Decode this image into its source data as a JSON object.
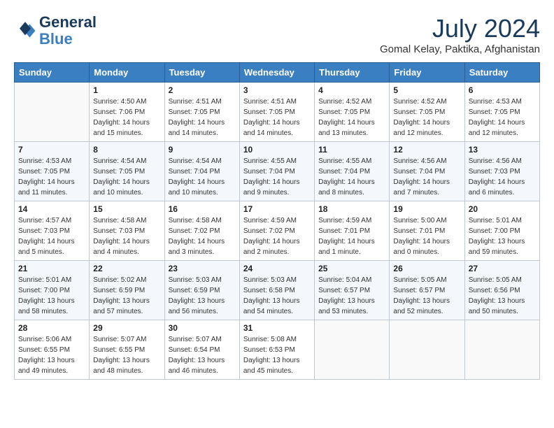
{
  "header": {
    "logo_line1": "General",
    "logo_line2": "Blue",
    "month_year": "July 2024",
    "location": "Gomal Kelay, Paktika, Afghanistan"
  },
  "weekdays": [
    "Sunday",
    "Monday",
    "Tuesday",
    "Wednesday",
    "Thursday",
    "Friday",
    "Saturday"
  ],
  "weeks": [
    [
      {
        "day": "",
        "sunrise": "",
        "sunset": "",
        "daylight": ""
      },
      {
        "day": "1",
        "sunrise": "Sunrise: 4:50 AM",
        "sunset": "Sunset: 7:06 PM",
        "daylight": "Daylight: 14 hours and 15 minutes."
      },
      {
        "day": "2",
        "sunrise": "Sunrise: 4:51 AM",
        "sunset": "Sunset: 7:05 PM",
        "daylight": "Daylight: 14 hours and 14 minutes."
      },
      {
        "day": "3",
        "sunrise": "Sunrise: 4:51 AM",
        "sunset": "Sunset: 7:05 PM",
        "daylight": "Daylight: 14 hours and 14 minutes."
      },
      {
        "day": "4",
        "sunrise": "Sunrise: 4:52 AM",
        "sunset": "Sunset: 7:05 PM",
        "daylight": "Daylight: 14 hours and 13 minutes."
      },
      {
        "day": "5",
        "sunrise": "Sunrise: 4:52 AM",
        "sunset": "Sunset: 7:05 PM",
        "daylight": "Daylight: 14 hours and 12 minutes."
      },
      {
        "day": "6",
        "sunrise": "Sunrise: 4:53 AM",
        "sunset": "Sunset: 7:05 PM",
        "daylight": "Daylight: 14 hours and 12 minutes."
      }
    ],
    [
      {
        "day": "7",
        "sunrise": "Sunrise: 4:53 AM",
        "sunset": "Sunset: 7:05 PM",
        "daylight": "Daylight: 14 hours and 11 minutes."
      },
      {
        "day": "8",
        "sunrise": "Sunrise: 4:54 AM",
        "sunset": "Sunset: 7:05 PM",
        "daylight": "Daylight: 14 hours and 10 minutes."
      },
      {
        "day": "9",
        "sunrise": "Sunrise: 4:54 AM",
        "sunset": "Sunset: 7:04 PM",
        "daylight": "Daylight: 14 hours and 10 minutes."
      },
      {
        "day": "10",
        "sunrise": "Sunrise: 4:55 AM",
        "sunset": "Sunset: 7:04 PM",
        "daylight": "Daylight: 14 hours and 9 minutes."
      },
      {
        "day": "11",
        "sunrise": "Sunrise: 4:55 AM",
        "sunset": "Sunset: 7:04 PM",
        "daylight": "Daylight: 14 hours and 8 minutes."
      },
      {
        "day": "12",
        "sunrise": "Sunrise: 4:56 AM",
        "sunset": "Sunset: 7:04 PM",
        "daylight": "Daylight: 14 hours and 7 minutes."
      },
      {
        "day": "13",
        "sunrise": "Sunrise: 4:56 AM",
        "sunset": "Sunset: 7:03 PM",
        "daylight": "Daylight: 14 hours and 6 minutes."
      }
    ],
    [
      {
        "day": "14",
        "sunrise": "Sunrise: 4:57 AM",
        "sunset": "Sunset: 7:03 PM",
        "daylight": "Daylight: 14 hours and 5 minutes."
      },
      {
        "day": "15",
        "sunrise": "Sunrise: 4:58 AM",
        "sunset": "Sunset: 7:03 PM",
        "daylight": "Daylight: 14 hours and 4 minutes."
      },
      {
        "day": "16",
        "sunrise": "Sunrise: 4:58 AM",
        "sunset": "Sunset: 7:02 PM",
        "daylight": "Daylight: 14 hours and 3 minutes."
      },
      {
        "day": "17",
        "sunrise": "Sunrise: 4:59 AM",
        "sunset": "Sunset: 7:02 PM",
        "daylight": "Daylight: 14 hours and 2 minutes."
      },
      {
        "day": "18",
        "sunrise": "Sunrise: 4:59 AM",
        "sunset": "Sunset: 7:01 PM",
        "daylight": "Daylight: 14 hours and 1 minute."
      },
      {
        "day": "19",
        "sunrise": "Sunrise: 5:00 AM",
        "sunset": "Sunset: 7:01 PM",
        "daylight": "Daylight: 14 hours and 0 minutes."
      },
      {
        "day": "20",
        "sunrise": "Sunrise: 5:01 AM",
        "sunset": "Sunset: 7:00 PM",
        "daylight": "Daylight: 13 hours and 59 minutes."
      }
    ],
    [
      {
        "day": "21",
        "sunrise": "Sunrise: 5:01 AM",
        "sunset": "Sunset: 7:00 PM",
        "daylight": "Daylight: 13 hours and 58 minutes."
      },
      {
        "day": "22",
        "sunrise": "Sunrise: 5:02 AM",
        "sunset": "Sunset: 6:59 PM",
        "daylight": "Daylight: 13 hours and 57 minutes."
      },
      {
        "day": "23",
        "sunrise": "Sunrise: 5:03 AM",
        "sunset": "Sunset: 6:59 PM",
        "daylight": "Daylight: 13 hours and 56 minutes."
      },
      {
        "day": "24",
        "sunrise": "Sunrise: 5:03 AM",
        "sunset": "Sunset: 6:58 PM",
        "daylight": "Daylight: 13 hours and 54 minutes."
      },
      {
        "day": "25",
        "sunrise": "Sunrise: 5:04 AM",
        "sunset": "Sunset: 6:57 PM",
        "daylight": "Daylight: 13 hours and 53 minutes."
      },
      {
        "day": "26",
        "sunrise": "Sunrise: 5:05 AM",
        "sunset": "Sunset: 6:57 PM",
        "daylight": "Daylight: 13 hours and 52 minutes."
      },
      {
        "day": "27",
        "sunrise": "Sunrise: 5:05 AM",
        "sunset": "Sunset: 6:56 PM",
        "daylight": "Daylight: 13 hours and 50 minutes."
      }
    ],
    [
      {
        "day": "28",
        "sunrise": "Sunrise: 5:06 AM",
        "sunset": "Sunset: 6:55 PM",
        "daylight": "Daylight: 13 hours and 49 minutes."
      },
      {
        "day": "29",
        "sunrise": "Sunrise: 5:07 AM",
        "sunset": "Sunset: 6:55 PM",
        "daylight": "Daylight: 13 hours and 48 minutes."
      },
      {
        "day": "30",
        "sunrise": "Sunrise: 5:07 AM",
        "sunset": "Sunset: 6:54 PM",
        "daylight": "Daylight: 13 hours and 46 minutes."
      },
      {
        "day": "31",
        "sunrise": "Sunrise: 5:08 AM",
        "sunset": "Sunset: 6:53 PM",
        "daylight": "Daylight: 13 hours and 45 minutes."
      },
      {
        "day": "",
        "sunrise": "",
        "sunset": "",
        "daylight": ""
      },
      {
        "day": "",
        "sunrise": "",
        "sunset": "",
        "daylight": ""
      },
      {
        "day": "",
        "sunrise": "",
        "sunset": "",
        "daylight": ""
      }
    ]
  ]
}
